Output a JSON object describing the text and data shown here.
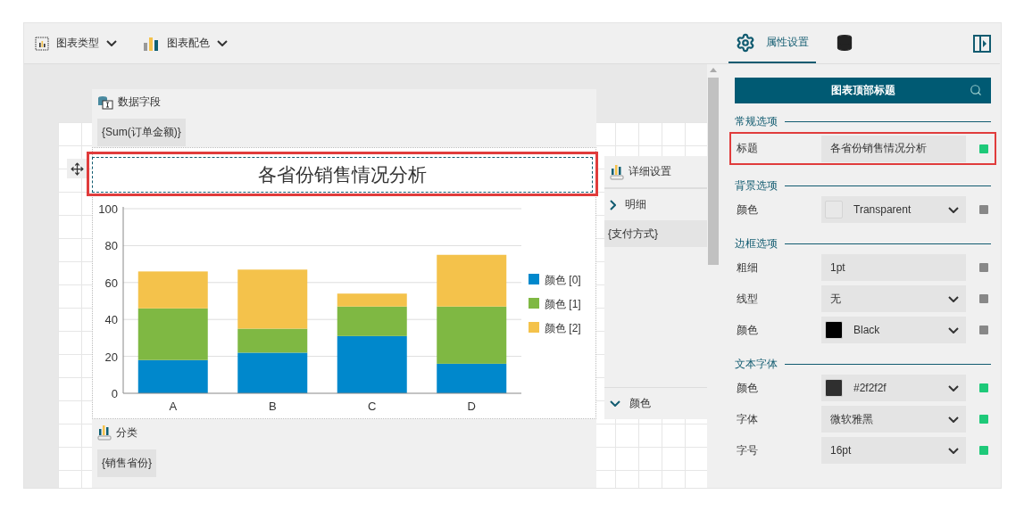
{
  "toolbar": {
    "items": [
      {
        "kind": "chart-type",
        "label": "图表类型"
      },
      {
        "kind": "palette",
        "label": "图表配色"
      }
    ]
  },
  "canvas": {
    "data_fields": {
      "title": "数据字段",
      "items": [
        "{Sum(订单金额)}"
      ]
    },
    "chart_title": {
      "text": "各省份销售情况分析",
      "highlighted": true
    },
    "chart_data": {
      "type": "bar",
      "stacked": true,
      "grid": true,
      "legend": true,
      "categories": [
        "A",
        "B",
        "C",
        "D"
      ],
      "ylim": [
        0,
        100
      ],
      "yticks": [
        0,
        20,
        40,
        60,
        80,
        100
      ],
      "series": [
        {
          "name": "颜色 [0]",
          "color": "#0088cc",
          "values": [
            18,
            22,
            31,
            16
          ]
        },
        {
          "name": "颜色 [1]",
          "color": "#7fb843",
          "values": [
            28,
            13,
            16,
            31
          ]
        },
        {
          "name": "颜色 [2]",
          "color": "#f4c24b",
          "values": [
            20,
            32,
            7,
            28
          ]
        }
      ]
    },
    "details": {
      "title": "详细设置",
      "sections": [
        {
          "label": "明细",
          "expanded": false,
          "items": [
            "{支付方式}"
          ]
        },
        {
          "label": "颜色",
          "expanded": true
        }
      ]
    },
    "category": {
      "title": "分类",
      "items": [
        "{销售省份}"
      ]
    }
  },
  "panel": {
    "tabs": [
      {
        "kind": "gear",
        "label": "属性设置",
        "selected": true
      },
      {
        "kind": "database",
        "selected": false
      }
    ],
    "search": {
      "value": "图表顶部标题"
    },
    "groups": [
      {
        "title": "常规选项",
        "rows": [
          {
            "label": "标题",
            "kind": "text",
            "value": "各省份销售情况分析",
            "bound": true,
            "highlighted": true
          }
        ]
      },
      {
        "title": "背景选项",
        "rows": [
          {
            "label": "颜色",
            "kind": "color",
            "value": "Transparent",
            "bound": false,
            "highlighted": false
          }
        ]
      },
      {
        "title": "边框选项",
        "rows": [
          {
            "label": "粗细",
            "kind": "text",
            "value": "1pt",
            "bound": false,
            "highlighted": false
          },
          {
            "label": "线型",
            "kind": "select",
            "value": "无",
            "bound": false,
            "highlighted": false
          },
          {
            "label": "颜色",
            "kind": "color",
            "color": "#000000",
            "value": "Black",
            "bound": false,
            "highlighted": false
          }
        ]
      },
      {
        "title": "文本字体",
        "rows": [
          {
            "label": "颜色",
            "kind": "color",
            "color": "#2f2f2f",
            "value": "#2f2f2f",
            "bound": true,
            "highlighted": false
          },
          {
            "label": "字体",
            "kind": "select",
            "value": "微软雅黑",
            "bound": true,
            "highlighted": false
          },
          {
            "label": "字号",
            "kind": "select",
            "value": "16pt",
            "bound": true,
            "highlighted": false
          }
        ]
      }
    ]
  }
}
